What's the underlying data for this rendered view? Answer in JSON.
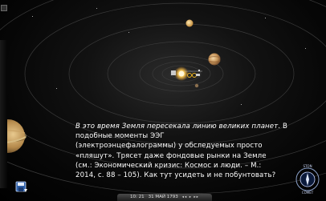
{
  "caption": {
    "line1_italic": "В это время Земля пересекала линию  великих планет",
    "line1_rest": ". В подобные моменты ЭЭГ",
    "line2": "(электроэнцефалограммы) у обследуемых просто",
    "line3": "«пляшут». Трясет даже фондовые рынки на Земле",
    "line4": "(см.: Экономический кризис: Космос и люди. – М.:",
    "line5": "2014, с. 88 – 105). Как тут усидеть и не побунтовать?"
  },
  "time_bar": {
    "time": "10: 21",
    "date": "31 МАЙ 1793",
    "controls": "◂◂ ▸ ▸▸"
  },
  "logo": {
    "text": "STON COMET"
  },
  "icons": {
    "save": "save-icon",
    "logo": "logo-icon"
  },
  "colors": {
    "caption_text": "#ffffff",
    "background": "#000000",
    "orbit": "#3a3a3a"
  }
}
